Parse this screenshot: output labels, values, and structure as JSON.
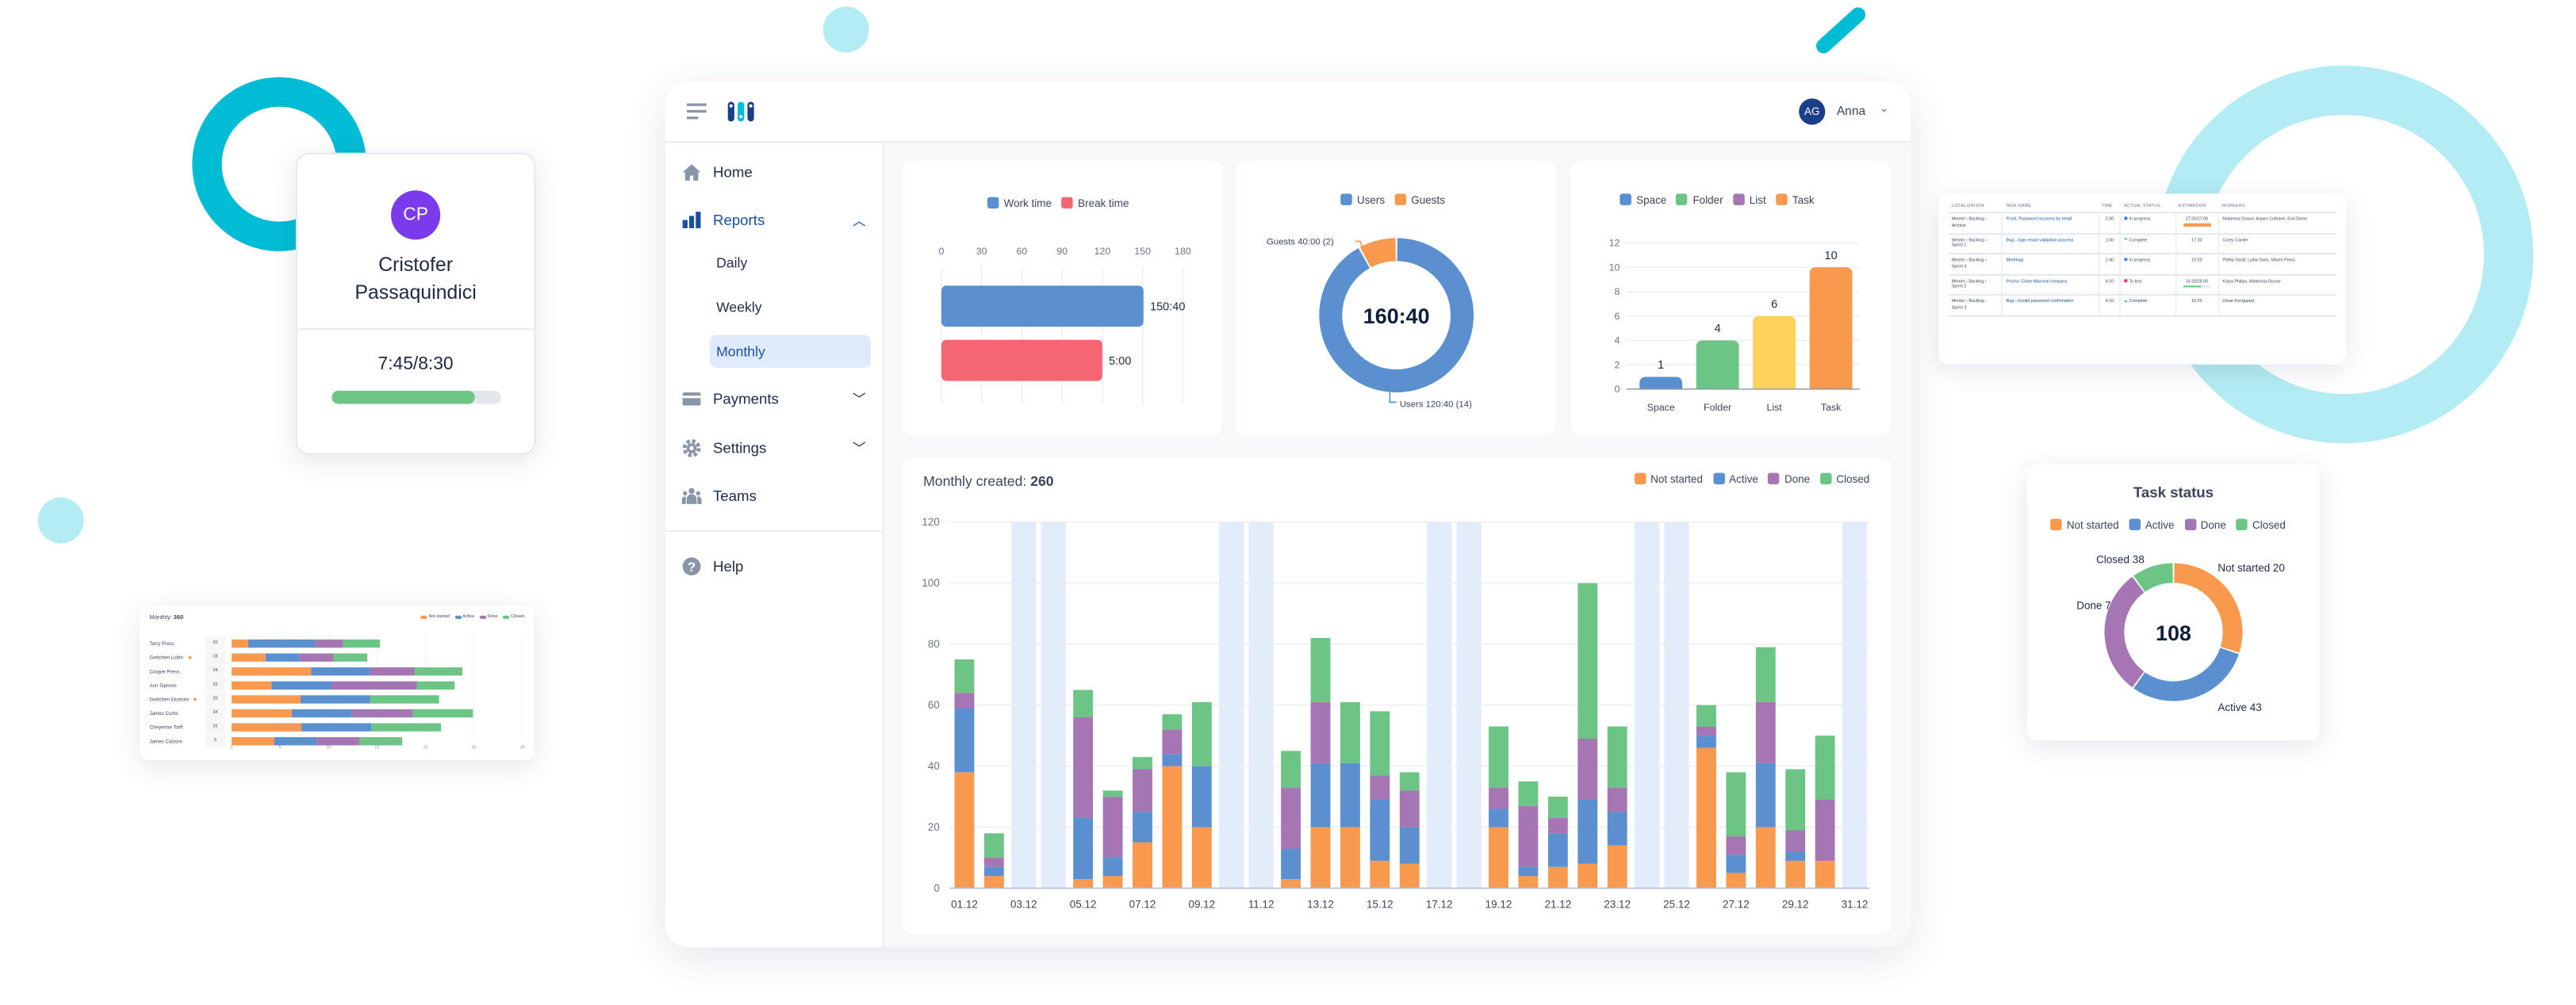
{
  "colors": {
    "not_started": "#f9994d",
    "active": "#5a90d0",
    "done": "#a576b3",
    "closed": "#6cc585",
    "yellow": "#fdd35c",
    "break": "#f56572",
    "weekend": "#e2ecfa",
    "accent": "#1a4fa0",
    "teal": "#00bcd4",
    "light_teal": "#b3ecf2",
    "avatar_purple": "#7c3aed"
  },
  "header": {
    "avatar_initials": "AG",
    "user_name": "Anna",
    "menu_icon": "hamburger-icon",
    "logo_icon": "app-logo"
  },
  "sidebar": {
    "home": "Home",
    "reports": "Reports",
    "daily": "Daily",
    "weekly": "Weekly",
    "monthly": "Monthly",
    "payments": "Payments",
    "settings": "Settings",
    "teams": "Teams",
    "help": "Help",
    "selected": "Monthly"
  },
  "work_chart": {
    "type": "bar",
    "orientation": "horizontal",
    "legend": [
      "Work time",
      "Break time"
    ],
    "ticks": [
      "0",
      "30",
      "60",
      "90",
      "120",
      "150",
      "180"
    ],
    "xlim": [
      0,
      180
    ],
    "bars": [
      {
        "name": "Work time",
        "value": 150.67,
        "label": "150:40",
        "color": "#5a90d0"
      },
      {
        "name": "Break time",
        "value": 120,
        "label": "5:00",
        "color": "#f56572"
      }
    ]
  },
  "users_chart": {
    "type": "pie",
    "legend": [
      "Users",
      "Guests"
    ],
    "center_label": "160:40",
    "slices": [
      {
        "name": "Users",
        "label": "Users 120:40 (14)",
        "share": 0.92,
        "color": "#5a90d0"
      },
      {
        "name": "Guests",
        "label": "Guests 40:00 (2)",
        "share": 0.08,
        "color": "#f9994d"
      }
    ]
  },
  "items_chart": {
    "type": "bar",
    "legend": [
      "Space",
      "Folder",
      "List",
      "Task"
    ],
    "categories": [
      "Space",
      "Folder",
      "List",
      "Task"
    ],
    "values": [
      1,
      4,
      6,
      10
    ],
    "colors": [
      "#5a90d0",
      "#6cc585",
      "#fdd35c",
      "#f9994d"
    ],
    "legend_colors": [
      "#5a90d0",
      "#6cc585",
      "#a576b3",
      "#f9994d"
    ],
    "yticks": [
      "0",
      "2",
      "4",
      "6",
      "8",
      "10",
      "12"
    ],
    "ylim": [
      0,
      12
    ]
  },
  "chart_data": {
    "type": "bar",
    "stacked": true,
    "title_prefix": "Monthly created:",
    "title_value": "260",
    "legend": [
      "Not started",
      "Active",
      "Done",
      "Closed"
    ],
    "legend_position": "top-right",
    "x_labels": [
      "01.12",
      "03.12",
      "05.12",
      "07.12",
      "09.12",
      "11.12",
      "13.12",
      "15.12",
      "17.12",
      "19.12",
      "21.12",
      "23.12",
      "25.12",
      "27.12",
      "29.12",
      "31.12"
    ],
    "days": 31,
    "weekend_days": [
      3,
      4,
      10,
      11,
      17,
      18,
      24,
      25,
      31
    ],
    "yticks": [
      "0",
      "20",
      "40",
      "60",
      "80",
      "100",
      "120"
    ],
    "ylim": [
      0,
      120
    ],
    "grid": true,
    "series": [
      {
        "name": "Not started",
        "values": [
          38,
          4,
          0,
          0,
          3,
          4,
          15,
          40,
          20,
          0,
          0,
          3,
          20,
          20,
          9,
          8,
          0,
          0,
          20,
          4,
          7,
          8,
          14,
          0,
          0,
          46,
          5,
          20,
          9,
          9,
          0
        ]
      },
      {
        "name": "Active",
        "values": [
          21,
          3,
          0,
          0,
          20,
          6,
          10,
          4,
          20,
          0,
          0,
          10,
          21,
          21,
          20,
          12,
          0,
          0,
          6,
          3,
          11,
          21,
          11,
          0,
          0,
          4,
          6,
          21,
          3,
          0,
          0
        ]
      },
      {
        "name": "Done",
        "values": [
          5,
          3,
          0,
          0,
          33,
          20,
          14,
          8,
          0,
          0,
          0,
          20,
          20,
          0,
          8,
          12,
          0,
          0,
          7,
          20,
          5,
          20,
          8,
          0,
          0,
          3,
          6,
          20,
          7,
          20,
          0
        ]
      },
      {
        "name": "Closed",
        "values": [
          11,
          8,
          0,
          0,
          9,
          2,
          4,
          5,
          21,
          0,
          0,
          12,
          21,
          20,
          21,
          6,
          0,
          0,
          20,
          8,
          7,
          51,
          20,
          0,
          0,
          7,
          21,
          18,
          20,
          21,
          0
        ]
      }
    ]
  },
  "profile": {
    "initials": "CP",
    "name_line1": "Cristofer",
    "name_line2": "Passaquindici",
    "time": "7:45/8:30",
    "progress": 0.84
  },
  "task_table": {
    "headers": [
      "LOCALIZATION",
      "TASK NAME",
      "TIME",
      "ACTUAL STATUS",
      "ESTIMATION",
      "WORKERS"
    ],
    "rows": [
      {
        "loc1": "Menter › Backlog ›",
        "loc2": "Archive",
        "task": "Front. Password recovery by email",
        "time": "2:30",
        "status": "In progress",
        "status_color": "#3b82f6",
        "estimation": "27:25/27:00",
        "est_progress": 1.0,
        "est_color": "#f9994d",
        "workers": "Makenna Gouse, Aspen Culhane, Erin Donin"
      },
      {
        "loc1": "Menter › Backlog ›",
        "loc2": "Sprint 1",
        "task": "Bug - login email validation process",
        "time": "1:30",
        "status": "Complete",
        "status_color": "#6cc585",
        "estimation": "17:30",
        "workers": "Corey Carder"
      },
      {
        "loc1": "Menter › Backlog ›",
        "loc2": "Sprint 3",
        "task": "Meetings",
        "time": "1:40",
        "status": "In progress",
        "status_color": "#3b82f6",
        "estimation": "10:20",
        "workers": "Phillip Geidt, Lydia Saris, Maren Press"
      },
      {
        "loc1": "Menter › Backlog ›",
        "loc2": "Sprint 2",
        "task": "Promo: Claire Marceal company",
        "time": "4:10",
        "status": "To test",
        "status_color": "#e2336b",
        "estimation": "14:25/25:00",
        "est_progress": 0.68,
        "est_color": "#6cc585",
        "workers": "Kaiya Philips, Makenna Gouse"
      },
      {
        "loc1": "Menter › Backlog ›",
        "loc2": "Sprint 3",
        "task": "Bug - invalid password confirmation",
        "time": "4:10",
        "status": "Complete",
        "status_color": "#6cc585",
        "estimation": "10:20",
        "workers": "Omar Korsgaard"
      }
    ]
  },
  "task_status": {
    "type": "pie",
    "title": "Task status",
    "center_label": "108",
    "legend": [
      "Not started",
      "Active",
      "Done",
      "Closed"
    ],
    "slices": [
      {
        "name": "Not started",
        "label": "Not started 20",
        "share": 0.3,
        "color": "#f9994d"
      },
      {
        "name": "Active",
        "label": "Active 43",
        "share": 0.3,
        "color": "#5a90d0"
      },
      {
        "name": "Done",
        "label": "Done 7",
        "share": 0.3,
        "color": "#a576b3"
      },
      {
        "name": "Closed",
        "label": "Closed 38",
        "share": 0.1,
        "color": "#6cc585"
      }
    ]
  },
  "mini_monthly": {
    "type": "bar",
    "orientation": "horizontal",
    "stacked": true,
    "title_prefix": "Monthly:",
    "title_value": "360",
    "legend": [
      "Not started",
      "Active",
      "Done",
      "Closed"
    ],
    "xticks": [
      "0",
      "5",
      "10",
      "15",
      "20",
      "25",
      "30"
    ],
    "xlim": [
      0,
      30
    ],
    "rows": [
      {
        "name": "Terry Press",
        "count": "20",
        "flag": false,
        "values": [
          1.7,
          6.9,
          2.9,
          3.8
        ]
      },
      {
        "name": "Gretchen Lubin",
        "count": "18",
        "flag": true,
        "values": [
          3.5,
          3.5,
          3.5,
          3.5
        ]
      },
      {
        "name": "Cooper Press",
        "count": "34",
        "flag": false,
        "values": [
          8.2,
          6.1,
          4.6,
          4.9
        ]
      },
      {
        "name": "Ann Siphron",
        "count": "32",
        "flag": false,
        "values": [
          4.1,
          6.2,
          8.8,
          3.9
        ]
      },
      {
        "name": "Gretchen Ekstrom",
        "count": "20",
        "flag": true,
        "values": [
          7.1,
          7.2,
          0,
          7.1
        ]
      },
      {
        "name": "James Curtis",
        "count": "34",
        "flag": false,
        "values": [
          6.2,
          6.2,
          6.3,
          6.2
        ]
      },
      {
        "name": "Cheyenne Torff",
        "count": "16",
        "flag": false,
        "values": [
          7.2,
          7.2,
          0,
          7.2
        ]
      },
      {
        "name": "James Calzoni",
        "count": "9",
        "flag": false,
        "values": [
          4.4,
          4.4,
          4.4,
          4.4
        ]
      }
    ]
  }
}
